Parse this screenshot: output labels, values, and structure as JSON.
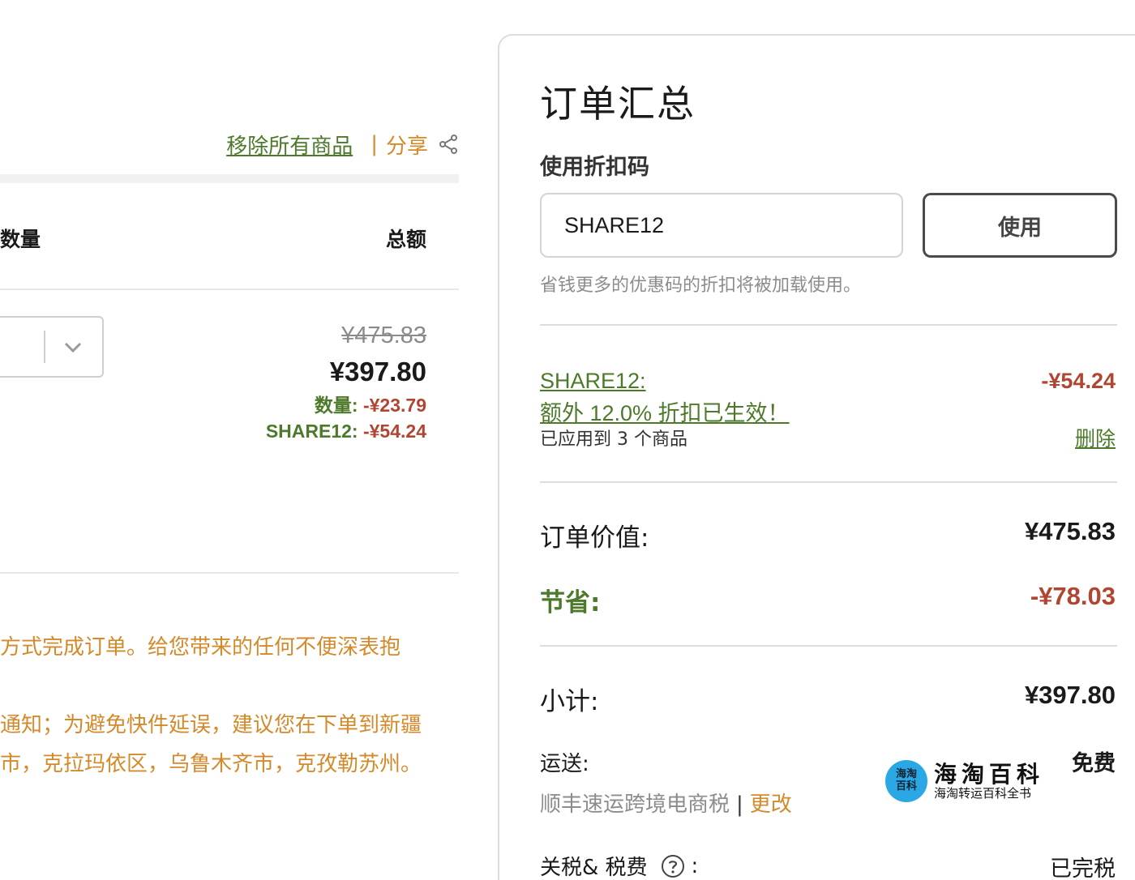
{
  "cart": {
    "remove_all": "移除所有商品",
    "separator": "|",
    "share": "分享",
    "col_quantity": "数量",
    "col_total": "总额",
    "item": {
      "original_price": "¥475.83",
      "price": "¥397.80",
      "qty_discount_label": "数量:",
      "qty_discount_value": "-¥23.79",
      "code_discount_label": "SHARE12:",
      "code_discount_value": "-¥54.24"
    },
    "notices": [
      "方式完成订单。给您带来的任何不便深表抱",
      "通知；为避免快件延误，建议您在下单到新疆",
      "市，克拉玛依区，乌鲁木齐市，克孜勒苏州。"
    ]
  },
  "summary": {
    "title": "订单汇总",
    "coupon_label": "使用折扣码",
    "coupon_value": "SHARE12",
    "apply_button": "使用",
    "hint": "省钱更多的优惠码的折扣将被加载使用。",
    "applied_code_line1": "SHARE12:",
    "applied_code_line2": "额外 12.0% 折扣已生效！",
    "applied_code_amount": "-¥54.24",
    "applied_note": "已应用到 3 个商品",
    "delete": "删除",
    "order_value_label": "订单价值:",
    "order_value": "¥475.83",
    "savings_label": "节省:",
    "savings_value": "-¥78.03",
    "subtotal_label": "小计:",
    "subtotal_value": "¥397.80",
    "shipping_label": "运送:",
    "shipping_value": "免费",
    "shipping_method": "顺丰速运跨境电商税",
    "shipping_sep": "|",
    "shipping_change": "更改",
    "tax_label": "关税& 税费",
    "tax_colon": ":",
    "tax_value": "已完税"
  },
  "watermark": {
    "badge_line1": "海淘",
    "badge_line2": "百科",
    "title": "海淘百科",
    "subtitle": "海淘转运百科全书"
  },
  "colors": {
    "green": "#4d7a2a",
    "orange": "#d48a2a",
    "red": "#b04532"
  }
}
